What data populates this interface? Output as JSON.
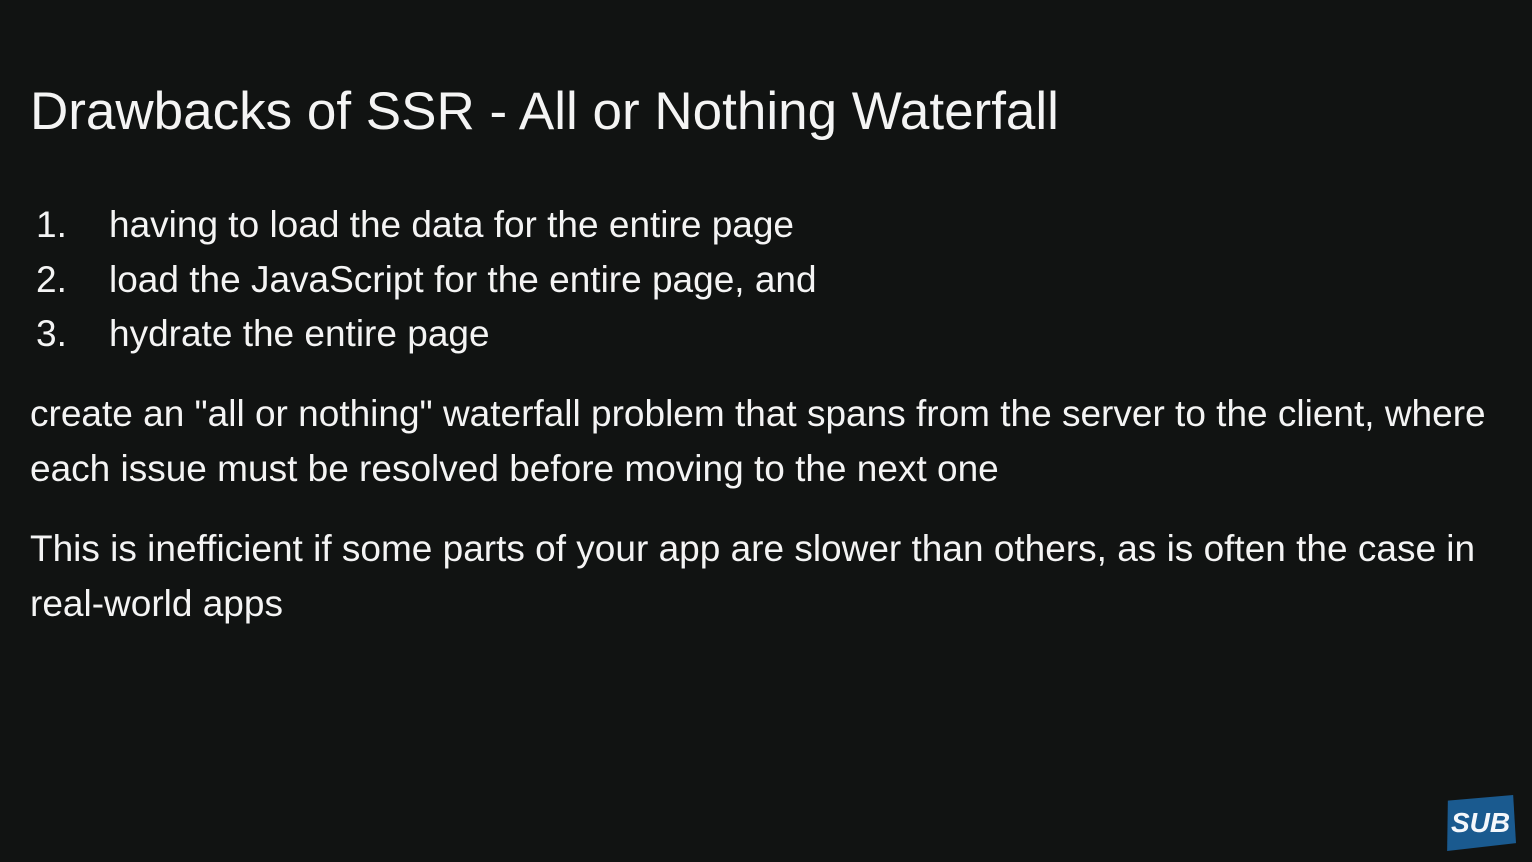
{
  "slide": {
    "title": "Drawbacks of SSR - All or Nothing Waterfall",
    "list": [
      {
        "number": "1.",
        "text": "having to load the data for the entire page"
      },
      {
        "number": "2.",
        "text": "load the JavaScript for the entire page, and"
      },
      {
        "number": "3.",
        "text": "hydrate the entire page"
      }
    ],
    "paragraph_1": "create an \"all or nothing\" waterfall problem that spans from the server to the client, where each issue must be resolved before moving to the next one",
    "paragraph_2": "This is inefficient if some parts of your app are slower than others, as is often the case in real-world apps"
  },
  "badge": {
    "label": "SUB"
  },
  "colors": {
    "background": "#111312",
    "text": "#f4f4f4",
    "badge": "#1a5a8f"
  }
}
